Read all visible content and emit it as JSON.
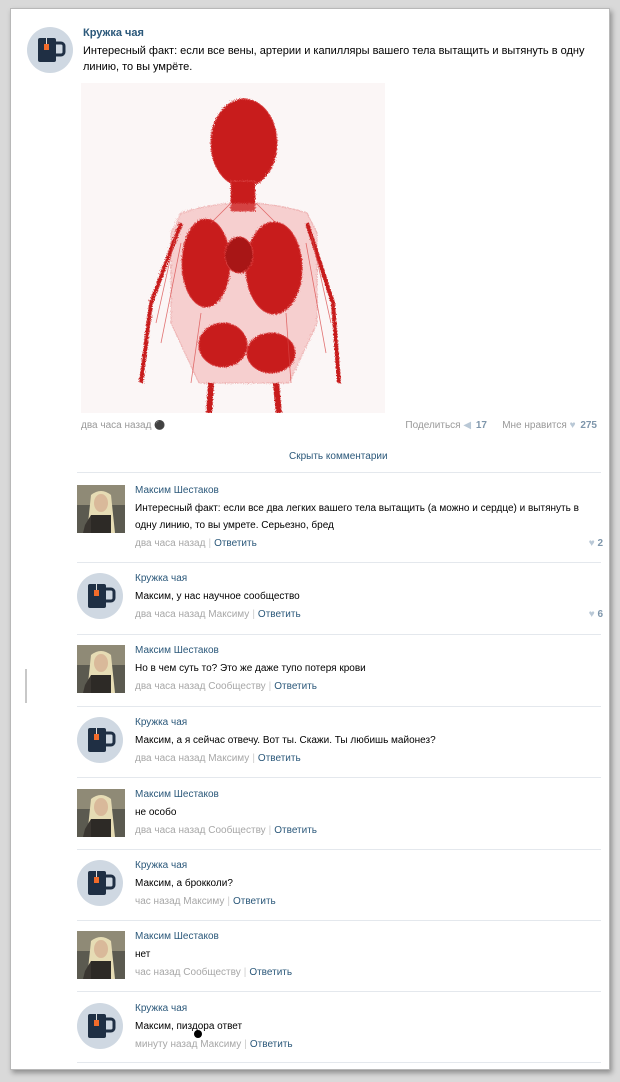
{
  "post": {
    "author": "Кружка чая",
    "text": "Интересный факт: если все вены, артерии и капилляры вашего тела вытащить и вытянуть в одну линию, то вы умрёте.",
    "image": "red-vascular-system",
    "time": "два часа назад",
    "share_label": "Поделиться",
    "share_count": "17",
    "like_label": "Мне нравится",
    "like_count": "275",
    "hide_comments": "Скрыть комментарии"
  },
  "icons": {
    "community_avatar": "tea-mug-icon",
    "user_avatar": "elf-portrait",
    "share": "megaphone-icon",
    "like": "heart-icon",
    "platform": "apple-icon"
  },
  "colors": {
    "link": "#2b587a",
    "meta": "#a7a7a7",
    "count": "#7e96ab",
    "vessels": "#c81e1e"
  },
  "comments": [
    {
      "author": "Максим Шестаков",
      "avatar": "user",
      "text": "Интересный факт: если все два легких вашего тела вытащить (а можно и сердце) и вытянуть в одну линию, то вы умрете. Серьезно, бред",
      "time": "два часа назад",
      "to": "",
      "reply": "Ответить",
      "likes": "2"
    },
    {
      "author": "Кружка чая",
      "avatar": "community",
      "text": "Максим, у нас научное сообщество",
      "time": "два часа назад",
      "to": "Максиму",
      "reply": "Ответить",
      "likes": "6"
    },
    {
      "author": "Максим Шестаков",
      "avatar": "user",
      "text": "Но в чем суть то? Это же даже тупо потеря крови",
      "time": "два часа назад",
      "to": "Сообществу",
      "reply": "Ответить",
      "likes": ""
    },
    {
      "author": "Кружка чая",
      "avatar": "community",
      "text": "Максим, а я сейчас отвечу. Вот ты. Скажи. Ты любишь майонез?",
      "time": "два часа назад",
      "to": "Максиму",
      "reply": "Ответить",
      "likes": ""
    },
    {
      "author": "Максим Шестаков",
      "avatar": "user",
      "text": "не особо",
      "time": "два часа назад",
      "to": "Сообществу",
      "reply": "Ответить",
      "likes": ""
    },
    {
      "author": "Кружка чая",
      "avatar": "community",
      "text": "Максим, а брокколи?",
      "time": "час назад",
      "to": "Максиму",
      "reply": "Ответить",
      "likes": ""
    },
    {
      "author": "Максим Шестаков",
      "avatar": "user",
      "text": "нет",
      "time": "час назад",
      "to": "Сообществу",
      "reply": "Ответить",
      "likes": ""
    },
    {
      "author": "Кружка чая",
      "avatar": "community",
      "text": "Максим, пиздора ответ",
      "time": "минуту назад",
      "to": "Максиму",
      "reply": "Ответить",
      "likes": ""
    }
  ]
}
